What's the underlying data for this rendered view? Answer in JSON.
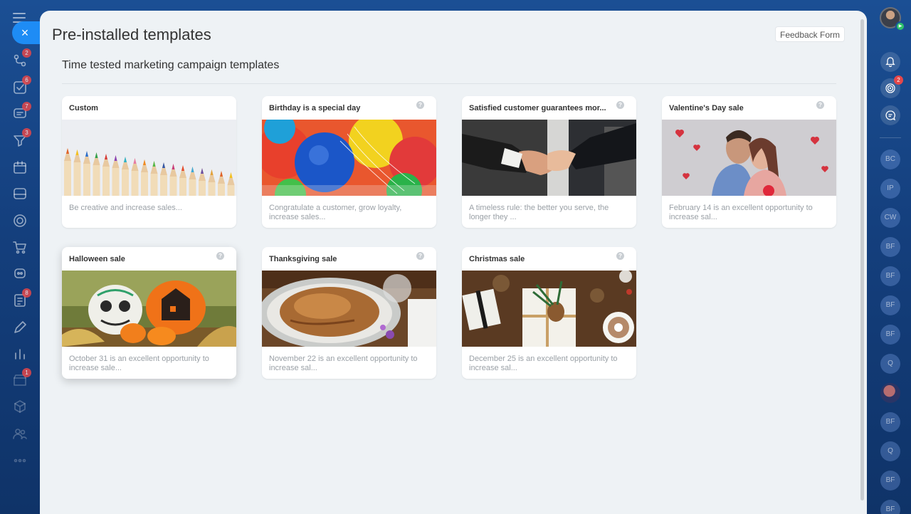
{
  "panel": {
    "title": "Pre-installed templates",
    "feedback_label": "Feedback Form",
    "subtitle": "Time tested marketing campaign templates"
  },
  "left_nav": {
    "close_glyph": "×",
    "items": [
      {
        "icon": "workflow-icon",
        "badge": "2"
      },
      {
        "icon": "tasks-icon",
        "badge": "6"
      },
      {
        "icon": "chat-icon",
        "badge": "7"
      },
      {
        "icon": "funnel-icon",
        "badge": "3"
      },
      {
        "icon": "calendar-icon",
        "badge": ""
      },
      {
        "icon": "drive-icon",
        "badge": ""
      },
      {
        "icon": "target-icon",
        "badge": ""
      },
      {
        "icon": "cart-icon",
        "badge": ""
      },
      {
        "icon": "robot-icon",
        "badge": ""
      },
      {
        "icon": "forms-icon",
        "badge": "8"
      },
      {
        "icon": "pen-icon",
        "badge": ""
      },
      {
        "icon": "chart-icon",
        "badge": ""
      },
      {
        "icon": "store-icon",
        "badge": "1"
      },
      {
        "icon": "cube-icon",
        "badge": ""
      },
      {
        "icon": "team-icon",
        "badge": ""
      },
      {
        "icon": "more-icon",
        "badge": ""
      }
    ]
  },
  "right_bar": {
    "play_glyph": "▶",
    "goals_badge": "2",
    "contacts": [
      "BC",
      "IP",
      "CW",
      "BF",
      "BF",
      "BF",
      "BF",
      "Q",
      "",
      "BF",
      "Q",
      "BF",
      "BF"
    ]
  },
  "templates": [
    {
      "title": "Custom",
      "description": "Be creative and increase sales...",
      "help": false,
      "image": "pencils-image"
    },
    {
      "title": "Birthday is a special day",
      "description": "Congratulate a customer, grow loyalty, increase sales...",
      "help": true,
      "image": "balloons-image"
    },
    {
      "title": "Satisfied customer guarantees mor...",
      "description": "A timeless rule: the better you serve, the longer they ...",
      "help": true,
      "image": "handshake-image"
    },
    {
      "title": "Valentine's Day sale",
      "description": "February 14 is an excellent opportunity to increase sal...",
      "help": true,
      "image": "couple-image"
    },
    {
      "title": "Halloween sale",
      "description": "October 31 is an excellent opportunity to increase sale...",
      "help": true,
      "image": "pumpkins-image"
    },
    {
      "title": "Thanksgiving sale",
      "description": "November 22 is an excellent opportunity to increase sal...",
      "help": true,
      "image": "turkey-image"
    },
    {
      "title": "Christmas sale",
      "description": "December 25 is an excellent opportunity to increase sal...",
      "help": true,
      "image": "gifts-image"
    }
  ],
  "help_glyph": "?"
}
